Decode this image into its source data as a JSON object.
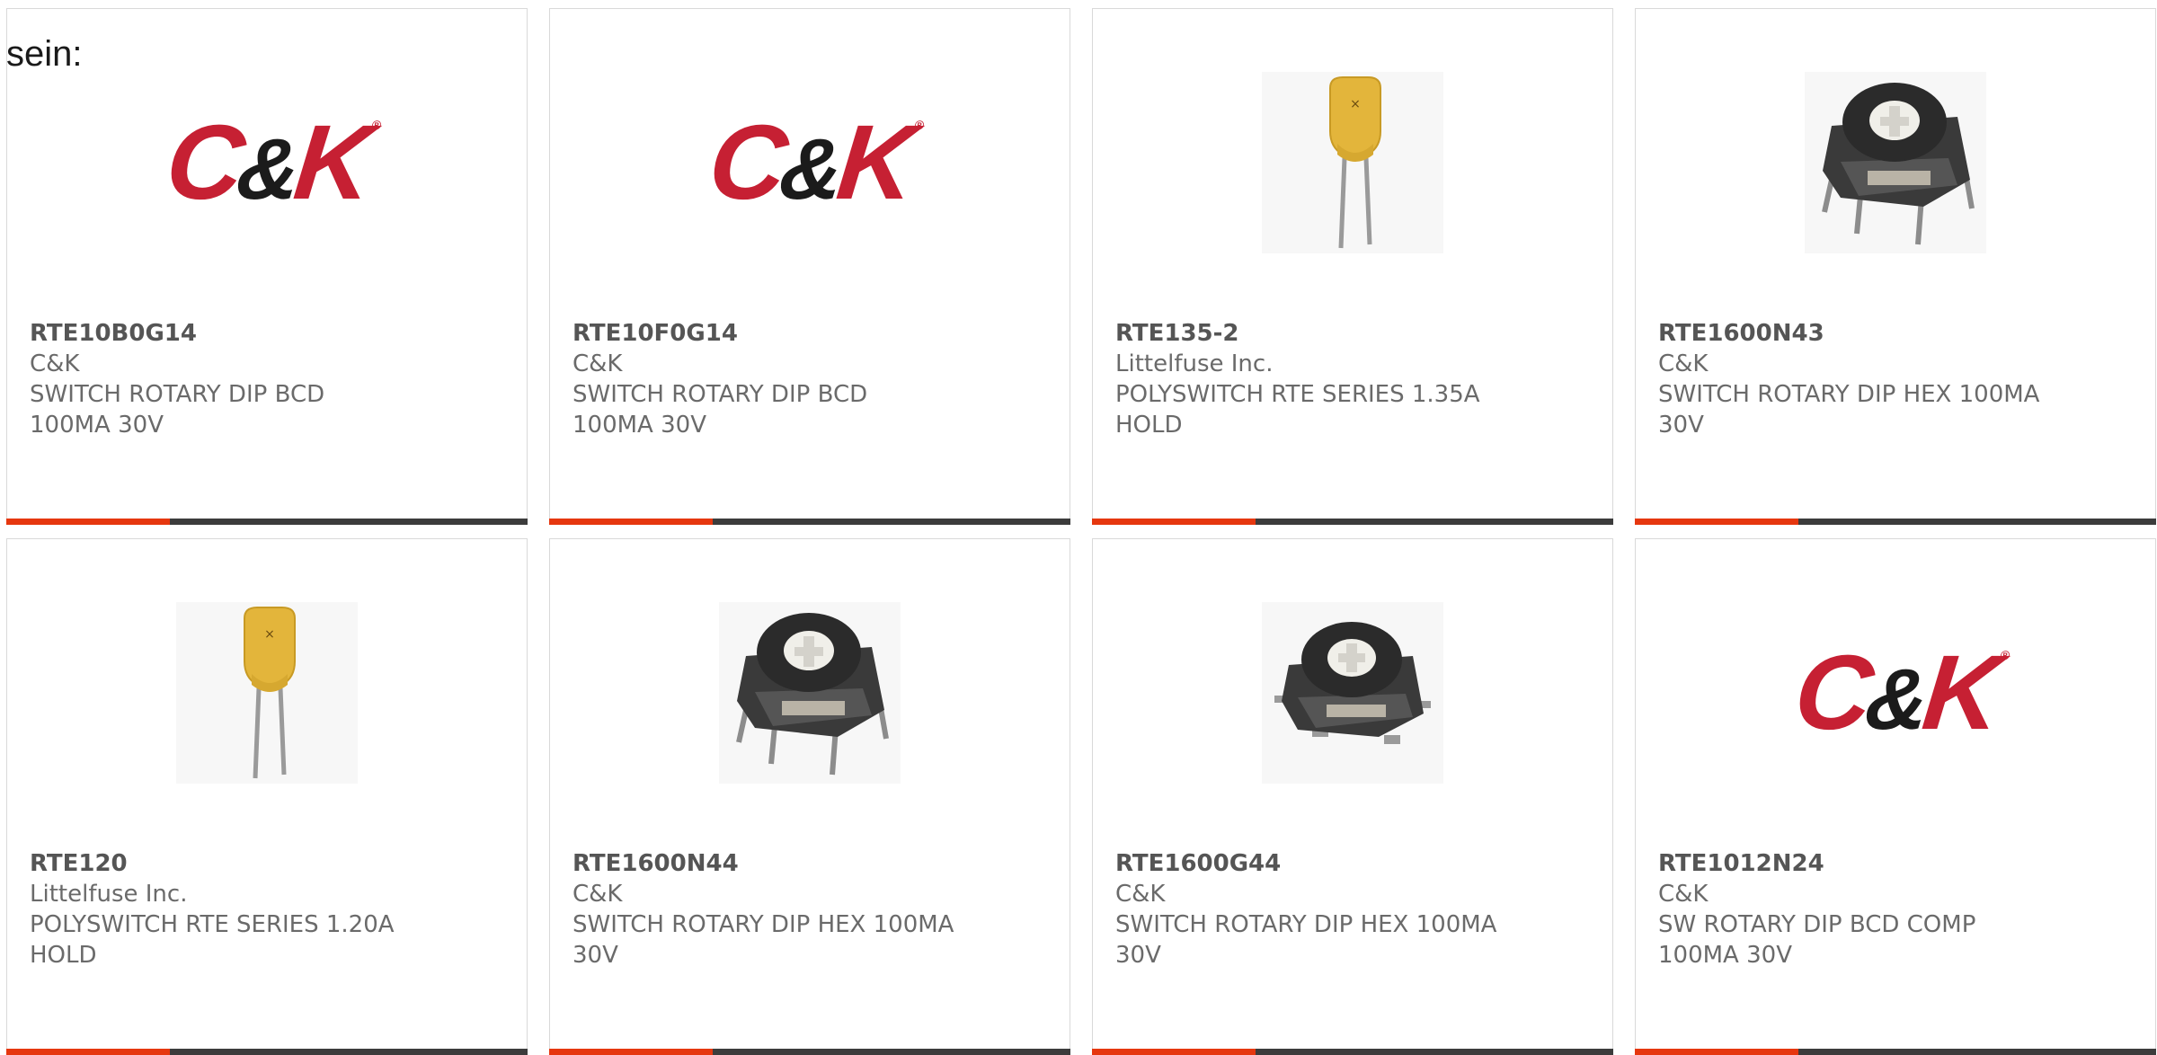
{
  "intro_text": "sein:",
  "colors": {
    "accent": "#e6370f",
    "bar": "#3c3c3c",
    "brand_red": "#c62033"
  },
  "products": [
    {
      "part_number": "RTE10B0G14",
      "manufacturer": "C&K",
      "description_line1": "SWITCH ROTARY DIP BCD",
      "description_line2": "100MA 30V",
      "image": "ck-logo"
    },
    {
      "part_number": "RTE10F0G14",
      "manufacturer": "C&K",
      "description_line1": "SWITCH ROTARY DIP BCD",
      "description_line2": "100MA 30V",
      "image": "ck-logo"
    },
    {
      "part_number": "RTE135-2",
      "manufacturer": "Littelfuse Inc.",
      "description_line1": "POLYSWITCH RTE SERIES 1.35A",
      "description_line2": "HOLD",
      "image": "polyswitch-fuse"
    },
    {
      "part_number": "RTE1600N43",
      "manufacturer": "C&K",
      "description_line1": "SWITCH ROTARY DIP HEX 100MA",
      "description_line2": "30V",
      "image": "rotary-dip-switch"
    },
    {
      "part_number": "RTE120",
      "manufacturer": "Littelfuse Inc.",
      "description_line1": "POLYSWITCH RTE SERIES 1.20A",
      "description_line2": "HOLD",
      "image": "polyswitch-fuse"
    },
    {
      "part_number": "RTE1600N44",
      "manufacturer": "C&K",
      "description_line1": "SWITCH ROTARY DIP HEX 100MA",
      "description_line2": "30V",
      "image": "rotary-dip-switch"
    },
    {
      "part_number": "RTE1600G44",
      "manufacturer": "C&K",
      "description_line1": "SWITCH ROTARY DIP HEX 100MA",
      "description_line2": "30V",
      "image": "rotary-dip-switch-smd"
    },
    {
      "part_number": "RTE1012N24",
      "manufacturer": "C&K",
      "description_line1": "SW ROTARY DIP BCD COMP",
      "description_line2": "100MA 30V",
      "image": "ck-logo"
    }
  ]
}
